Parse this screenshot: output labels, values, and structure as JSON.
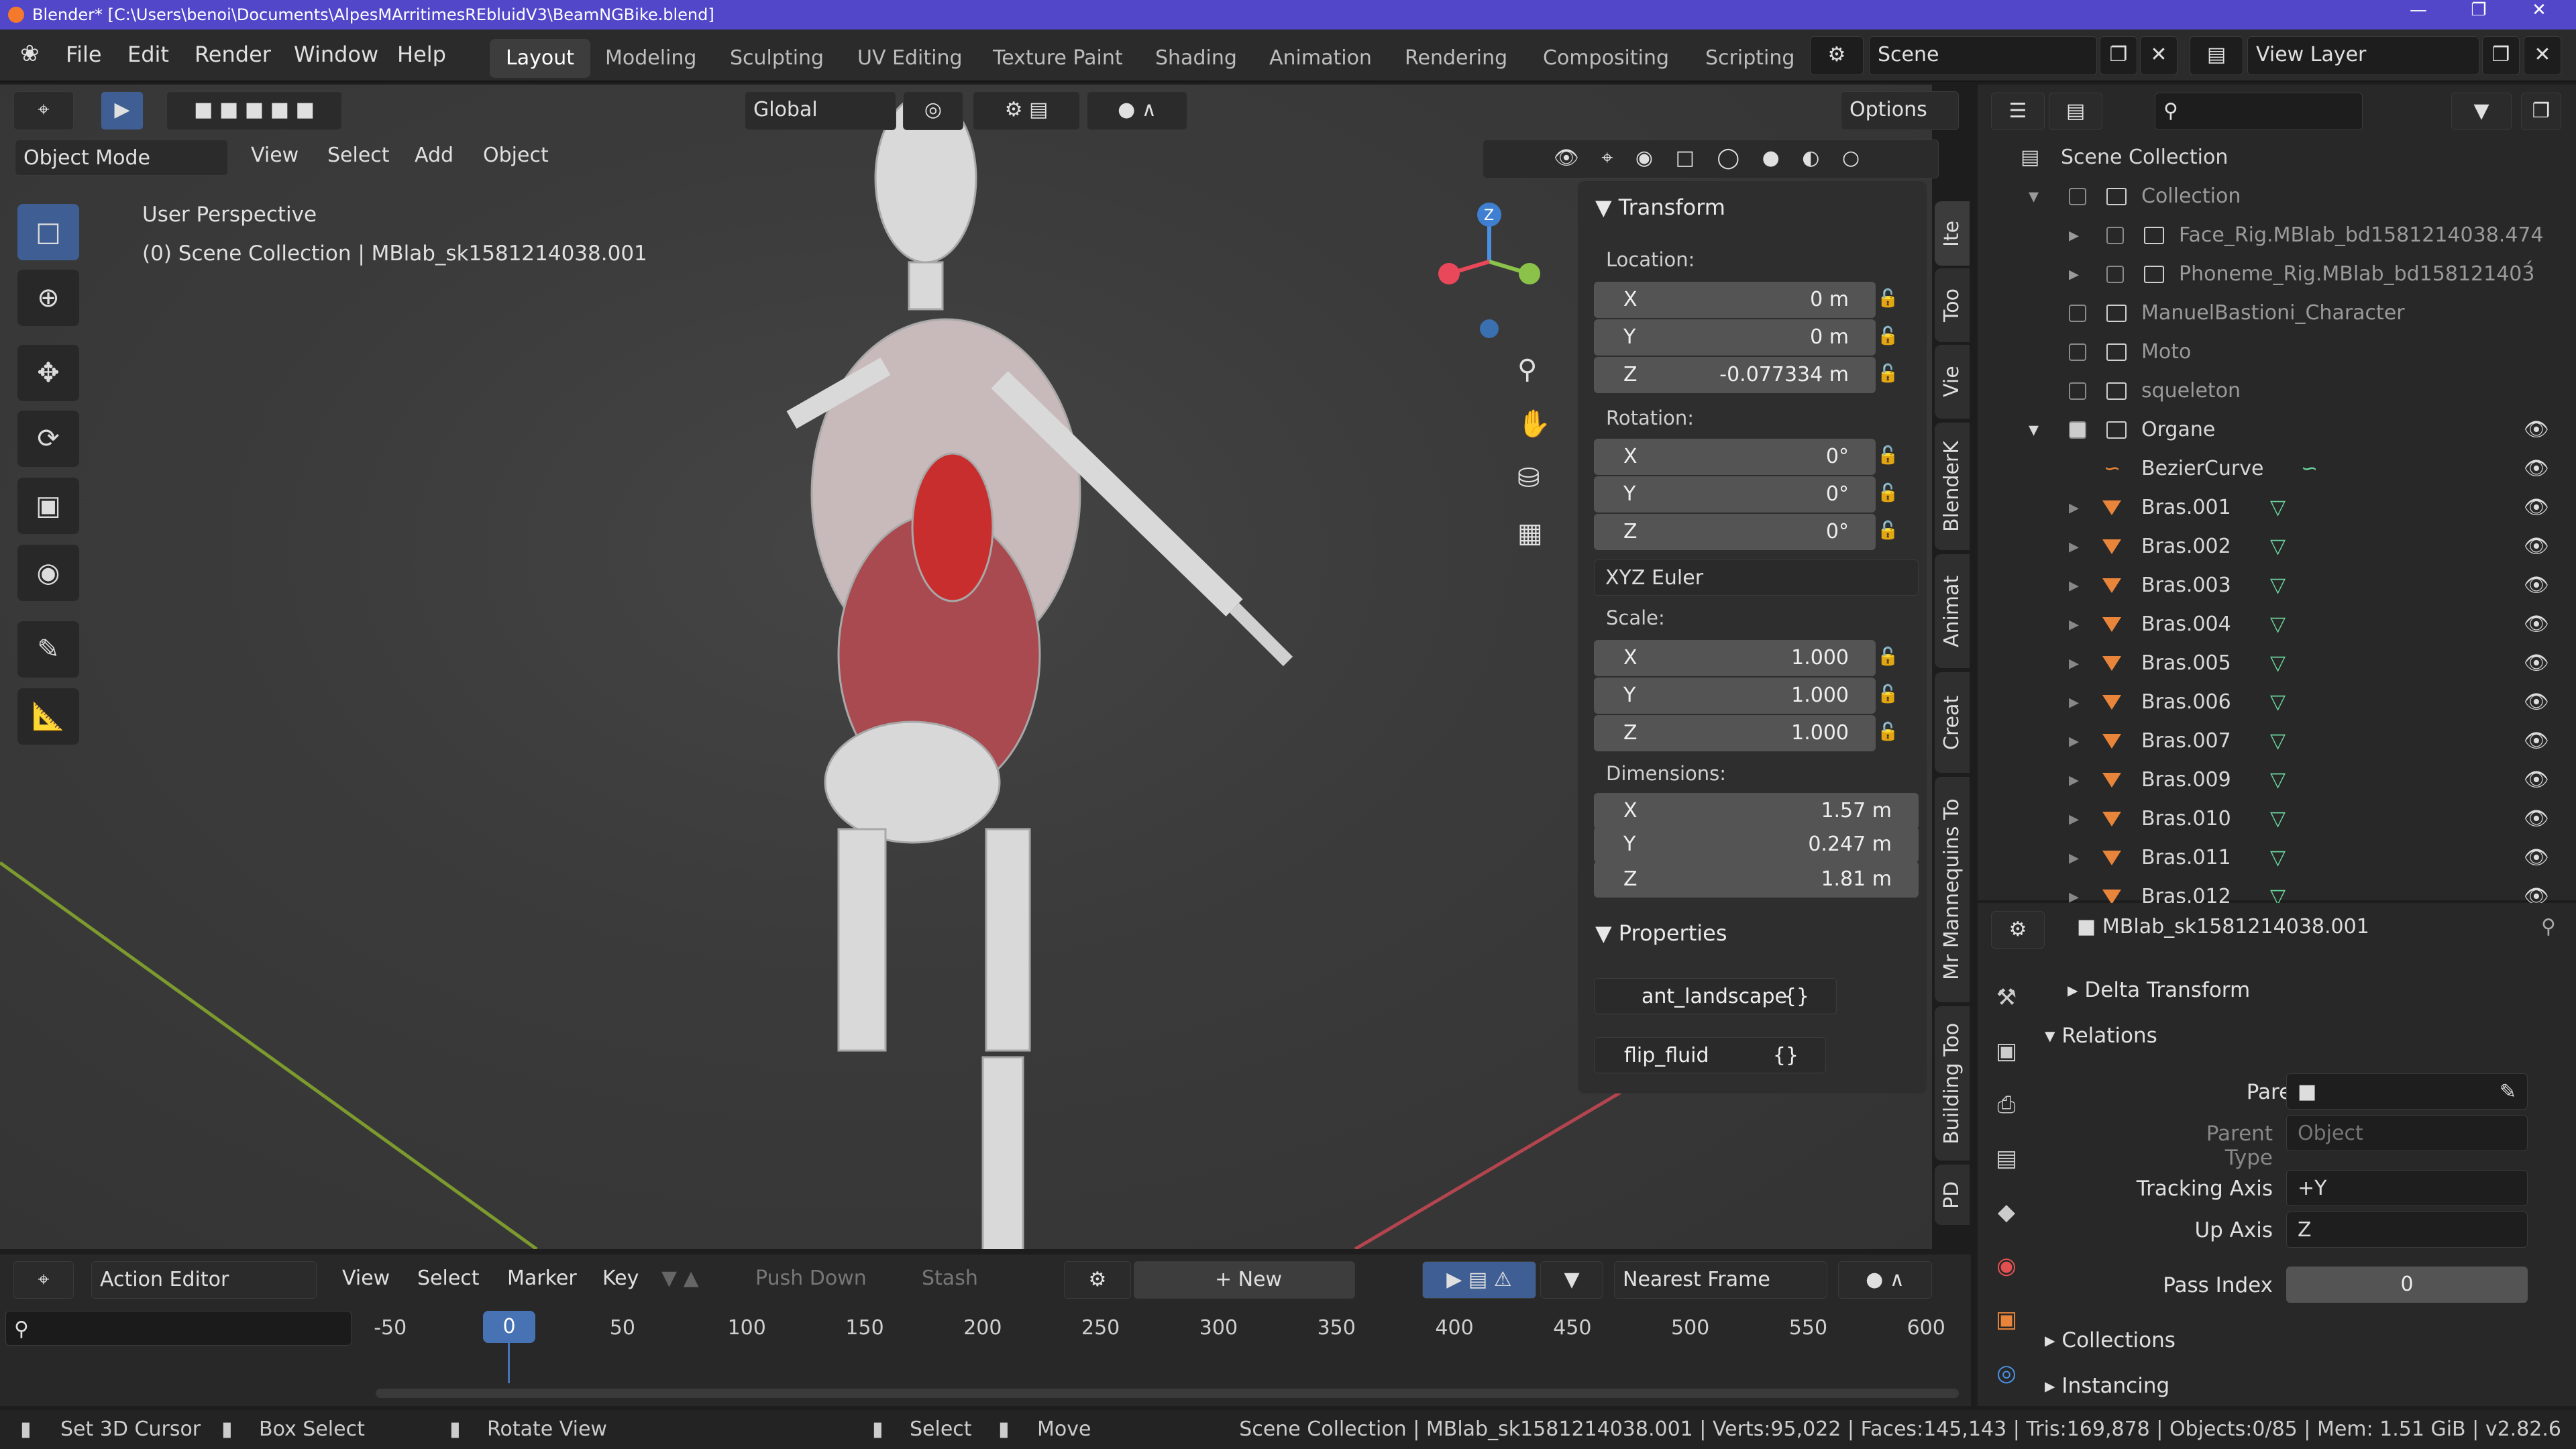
{
  "title": "Blender* [C:\\Users\\benoi\\Documents\\AlpesMArritimesREbluidV3\\BeamNGBike.blend]",
  "menu": [
    "File",
    "Edit",
    "Render",
    "Window",
    "Help"
  ],
  "workspaces": [
    "Layout",
    "Modeling",
    "Sculpting",
    "UV Editing",
    "Texture Paint",
    "Shading",
    "Animation",
    "Rendering",
    "Compositing",
    "Scripting"
  ],
  "scene": "Scene",
  "view_layer": "View Layer",
  "viewport": {
    "transform_orientation": "Global",
    "options": "Options",
    "mode": "Object Mode",
    "menus": [
      "View",
      "Select",
      "Add",
      "Object"
    ],
    "perspective": "User Perspective",
    "collection_info": "(0) Scene Collection | MBlab_sk1581214038.001",
    "gizmo_z": "Z"
  },
  "transform": {
    "header": "Transform",
    "location_label": "Location:",
    "location": {
      "x": "0 m",
      "y": "0 m",
      "z": "-0.077334 m"
    },
    "rotation_label": "Rotation:",
    "rotation": {
      "x": "0°",
      "y": "0°",
      "z": "0°"
    },
    "rotation_mode": "XYZ Euler",
    "scale_label": "Scale:",
    "scale": {
      "x": "1.000",
      "y": "1.000",
      "z": "1.000"
    },
    "dimensions_label": "Dimensions:",
    "dimensions": {
      "x": "1.57 m",
      "y": "0.247 m",
      "z": "1.81 m"
    },
    "axes": [
      "X",
      "Y",
      "Z"
    ]
  },
  "custom_properties": {
    "header": "Properties",
    "items": [
      "ant_landscape",
      "flip_fluid"
    ],
    "value": "{}"
  },
  "side_tabs": [
    "Ite",
    "Too",
    "Vie",
    "BlenderK",
    "Animat",
    "Creat",
    "Mr Mannequins To",
    "Building Too",
    "PD"
  ],
  "outliner": {
    "scene_collection": "Scene Collection",
    "collection": "Collection",
    "face_rig": "Face_Rig.MBlab_bd1581214038.474",
    "phoneme_rig": "Phoneme_Rig.MBlab_bd158121403́",
    "character": "ManuelBastioni_Character",
    "moto": "Moto",
    "squeleton": "squeleton",
    "organe": "Organe",
    "bezier": "BezierCurve",
    "bras": [
      "Bras.001",
      "Bras.002",
      "Bras.003",
      "Bras.004",
      "Bras.005",
      "Bras.006",
      "Bras.007",
      "Bras.009",
      "Bras.010",
      "Bras.011",
      "Bras.012"
    ]
  },
  "properties": {
    "object_name": "MBlab_sk1581214038.001",
    "delta_transform": "Delta Transform",
    "relations": "Relations",
    "parent_label": "Parent",
    "parent_type_label": "Parent Type",
    "parent_type_value": "Object",
    "tracking_axis_label": "Tracking Axis",
    "tracking_axis_value": "+Y",
    "up_axis_label": "Up Axis",
    "up_axis_value": "Z",
    "pass_index_label": "Pass Index",
    "pass_index_value": "0",
    "collections": "Collections",
    "instancing": "Instancing"
  },
  "timeline": {
    "editor": "Action Editor",
    "menus": [
      "View",
      "Select",
      "Marker",
      "Key"
    ],
    "push_down": "Push Down",
    "stash": "Stash",
    "new": "New",
    "snap": "Nearest Frame",
    "current_frame": "0",
    "ticks": [
      "-50",
      "50",
      "100",
      "150",
      "200",
      "250",
      "300",
      "350",
      "400",
      "450",
      "500",
      "550",
      "600"
    ]
  },
  "status": {
    "set_cursor": "Set 3D Cursor",
    "box_select": "Box Select",
    "rotate_view": "Rotate View",
    "select": "Select",
    "move": "Move",
    "stats": "Scene Collection | MBlab_sk1581214038.001 | Verts:95,022 | Faces:145,143 | Tris:169,878 | Objects:0/85 | Mem: 1.51 GiB | v2.82.6"
  },
  "colors": {
    "accent": "#5247c9",
    "active_blue": "#3f5f94",
    "mesh_green": "#6ad39b",
    "orange": "#e8853a"
  }
}
